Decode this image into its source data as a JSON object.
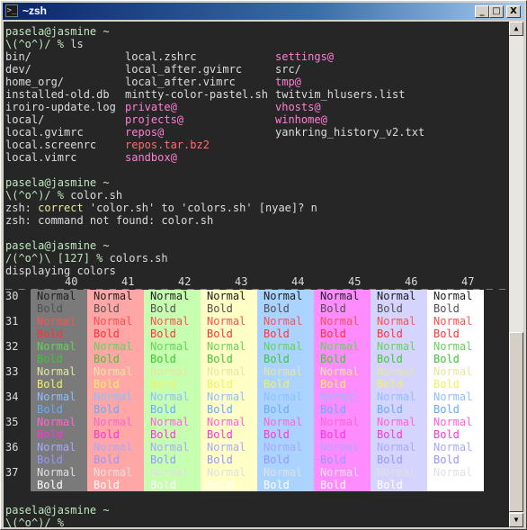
{
  "window": {
    "title": "~zsh",
    "minimize": "_",
    "maximize": "□",
    "close": "X"
  },
  "terminal": {
    "prompt_user": "pasela@jasmine ~",
    "prompt_face": "\\(^o^)/ %",
    "cmd1": " ls",
    "ls": {
      "col1": [
        "bin/",
        "dev/",
        "home_org/",
        "installed-old.db",
        "iroiro-update.log",
        "local/",
        "local.gvimrc",
        "local.screenrc",
        "local.vimrc"
      ],
      "col2": [
        "local.zshrc",
        "local_after.gvimrc",
        "local_after.vimrc",
        "mintty-color-pastel.sh",
        "private@",
        "projects@",
        "repos@",
        "repos.tar.bz2",
        "sandbox@"
      ],
      "col3": [
        "settings@",
        "src/",
        "tmp@",
        "twitvim_hlusers.list",
        "vhosts@",
        "winhome@",
        "yankring_history_v2.txt"
      ]
    },
    "cmd2": " color.sh",
    "correct_line_a": "zsh: ",
    "correct_word": "correct",
    "correct_line_b": " 'color.sh' to 'colors.sh' [nyae]? n",
    "notfound_line": "zsh: command not found: color.sh",
    "prompt_face_err": "/(^o^)\\ [127] %",
    "cmd3": " colors.sh",
    "displaying": "displaying colors",
    "header_dashes": "_ _ _ _ _ _ _ _ _ _ _ _ _ _ _ _ _ _ _ _ _ _ _ _ _ _ _ _ _ _ _ _ _ _ _ _ _ _ _ _ _ _",
    "columns": [
      "40",
      "41",
      "42",
      "43",
      "44",
      "45",
      "46",
      "47"
    ],
    "rows": [
      "30",
      "31",
      "32",
      "33",
      "34",
      "35",
      "36",
      "37"
    ],
    "normal_label": "Normal",
    "bold_label": "Bold",
    "final_prompt_face": "\\(^o^)/ %"
  },
  "colors": {
    "bg": [
      "#7a7a7a",
      "#ffa6a6",
      "#c6ffb0",
      "#ffffc6",
      "#aad4ff",
      "#ff8cff",
      "#d4d4ff",
      "#ffffff"
    ],
    "fg_normal": [
      "#202020",
      "#ff5050",
      "#64d25a",
      "#e6e6a0",
      "#8ebeff",
      "#ff64d2",
      "#a8a8ff",
      "#e0e0e0"
    ],
    "fg_bold": [
      "#505050",
      "#ff3232",
      "#3cc832",
      "#f0f064",
      "#64aaff",
      "#ff32dc",
      "#9696ff",
      "#ffffff"
    ]
  }
}
